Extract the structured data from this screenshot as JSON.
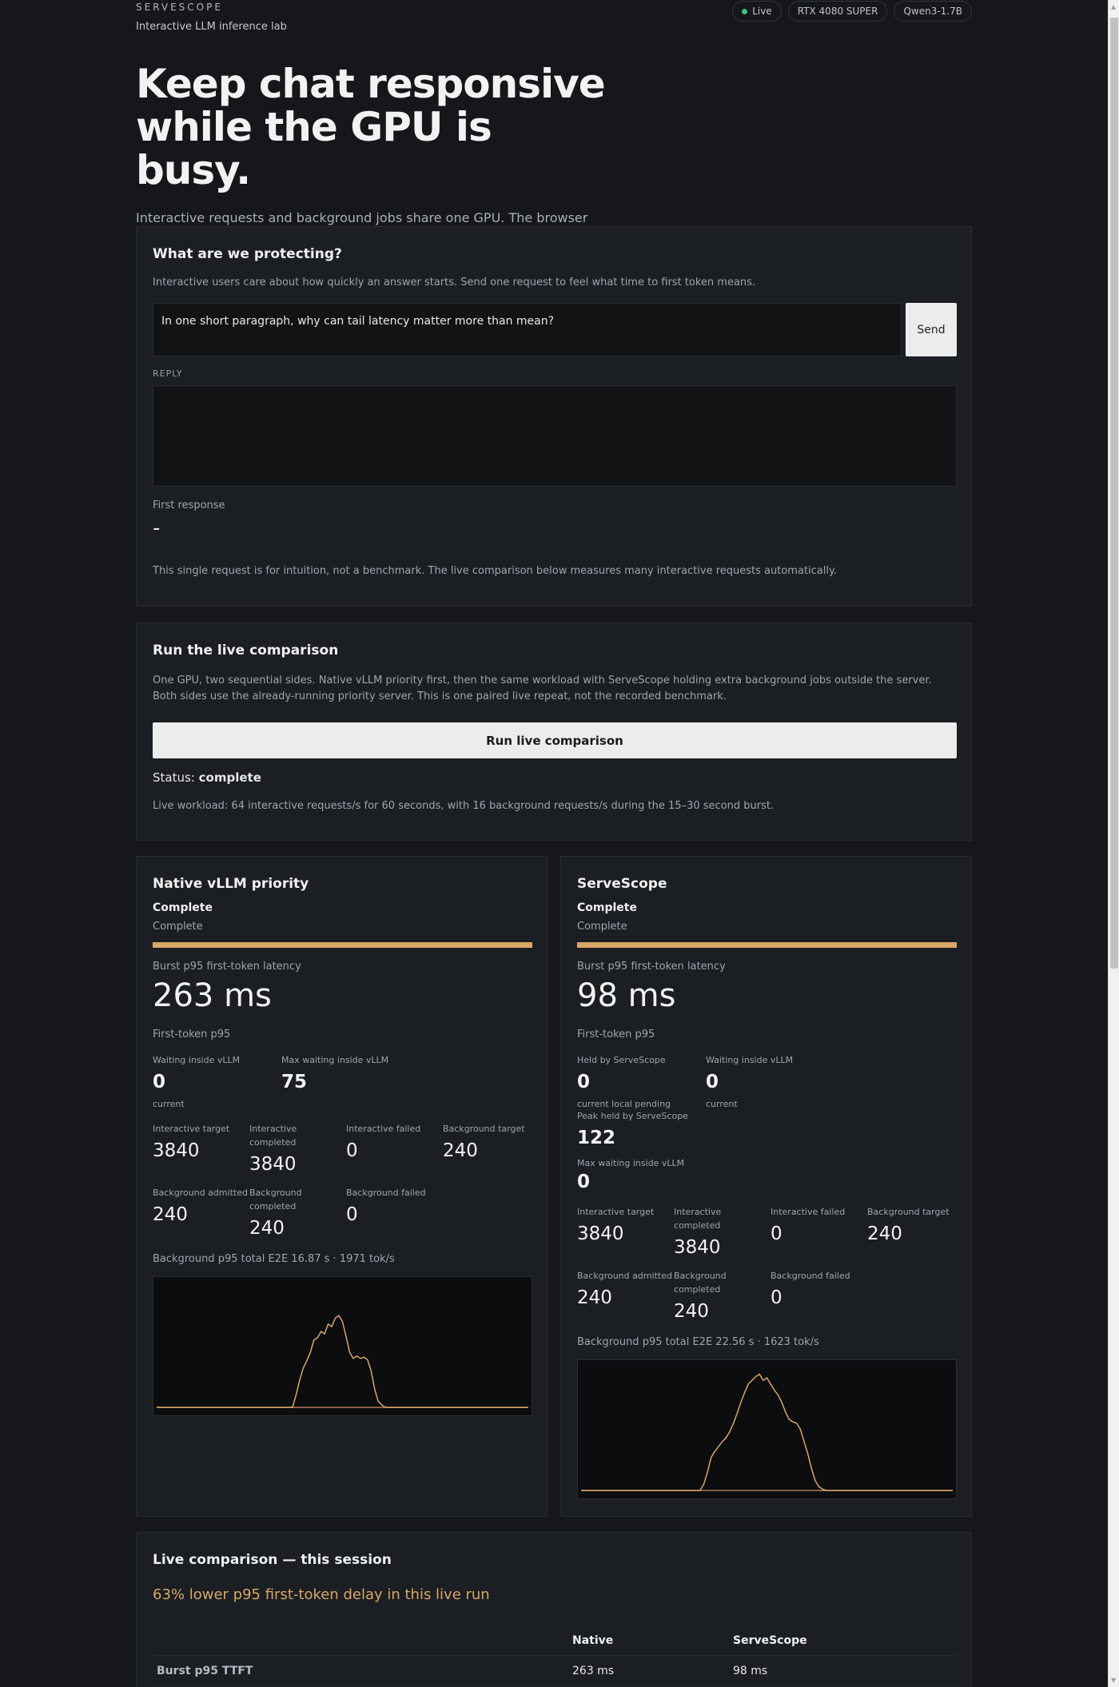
{
  "header": {
    "brand": "SERVESCOPE",
    "tagline": "Interactive LLM inference lab",
    "pills": {
      "live": "Live",
      "gpu": "RTX 4080 SUPER",
      "model": "Qwen3-1.7B"
    }
  },
  "hero": {
    "title": "Keep chat responsive while the GPU is busy.",
    "subtitle": "Interactive requests and background jobs share one GPU. The browser can run one paired comparison of native priority versus ServeScope admission."
  },
  "protect": {
    "title": "What are we protecting?",
    "intro": "Interactive users care about how quickly an answer starts. Send one request to feel what time to first token means.",
    "prompt_value": "In one short paragraph, why can tail latency matter more than mean?",
    "send_label": "Send",
    "reply_label": "REPLY",
    "reply_value": "",
    "first_response_label": "First response",
    "first_response_value": "-",
    "note": "This single request is for intuition, not a benchmark. The live comparison below measures many interactive requests automatically."
  },
  "run": {
    "title": "Run the live comparison",
    "description": "One GPU, two sequential sides. Native vLLM priority first, then the same workload with ServeScope holding extra background jobs outside the server. Both sides use the already-running priority server. This is one paired live repeat, not the recorded benchmark.",
    "button_label": "Run live comparison",
    "status_label": "Status:",
    "status_value": "complete",
    "workload": "Live workload: 64 interactive requests/s for 60 seconds, with 16 background requests/s during the 15–30 second burst."
  },
  "native": {
    "title": "Native vLLM priority",
    "state": "Complete",
    "state_sub": "Complete",
    "progress": 1.0,
    "metric_label": "Burst p95 first-token latency",
    "metric_value": "263 ms",
    "sub_label": "First-token p95",
    "waiting_label": "Waiting inside vLLM",
    "waiting_value": "0",
    "waiting_caption": "current",
    "max_waiting_label": "Max waiting inside vLLM",
    "max_waiting_value": "75",
    "stats": [
      {
        "label": "Interactive target",
        "value": "3840"
      },
      {
        "label": "Interactive completed",
        "value": "3840"
      },
      {
        "label": "Interactive failed",
        "value": "0"
      },
      {
        "label": "Background target",
        "value": "240"
      },
      {
        "label": "Background admitted",
        "value": "240"
      },
      {
        "label": "Background completed",
        "value": "240"
      },
      {
        "label": "Background failed",
        "value": "0"
      }
    ],
    "bg_line": "Background p95 total E2E 16.87 s · 1971 tok/s",
    "series": [
      0,
      0,
      0,
      0,
      0,
      0,
      0,
      0,
      0,
      0,
      0,
      0,
      0,
      0,
      0,
      0,
      0,
      0,
      0,
      0,
      0,
      0,
      0,
      0,
      0,
      0,
      0,
      0,
      0,
      0,
      0,
      0,
      0,
      0,
      0,
      0,
      0,
      0,
      0,
      0.1,
      0.22,
      0.32,
      0.38,
      0.45,
      0.55,
      0.57,
      0.62,
      0.6,
      0.68,
      0.66,
      0.73,
      0.75,
      0.7,
      0.58,
      0.45,
      0.4,
      0.42,
      0.4,
      0.41,
      0.39,
      0.3,
      0.15,
      0.05,
      0.02,
      0,
      0,
      0,
      0,
      0,
      0,
      0,
      0,
      0,
      0,
      0,
      0,
      0,
      0,
      0,
      0,
      0,
      0,
      0,
      0,
      0,
      0,
      0,
      0,
      0,
      0,
      0,
      0,
      0,
      0,
      0,
      0,
      0,
      0,
      0,
      0,
      0,
      0,
      0,
      0,
      0
    ]
  },
  "serve": {
    "title": "ServeScope",
    "state": "Complete",
    "state_sub": "Complete",
    "progress": 1.0,
    "metric_label": "Burst p95 first-token latency",
    "metric_value": "98 ms",
    "sub_label": "First-token p95",
    "held_label": "Held by ServeScope",
    "held_value": "0",
    "held_caption": "current local pending",
    "waiting_label": "Waiting inside vLLM",
    "waiting_value": "0",
    "waiting_caption": "current",
    "peak_label": "Peak held by ServeScope",
    "peak_value": "122",
    "max_waiting_label": "Max waiting inside vLLM",
    "max_waiting_value": "0",
    "stats": [
      {
        "label": "Interactive target",
        "value": "3840"
      },
      {
        "label": "Interactive completed",
        "value": "3840"
      },
      {
        "label": "Interactive failed",
        "value": "0"
      },
      {
        "label": "Background target",
        "value": "240"
      },
      {
        "label": "Background admitted",
        "value": "240"
      },
      {
        "label": "Background completed",
        "value": "240"
      },
      {
        "label": "Background failed",
        "value": "0"
      }
    ],
    "bg_line": "Background p95 total E2E 22.56 s · 1623 tok/s",
    "series": [
      0,
      0,
      0,
      0,
      0,
      0,
      0,
      0,
      0,
      0,
      0,
      0,
      0,
      0,
      0,
      0,
      0,
      0,
      0,
      0,
      0,
      0,
      0,
      0,
      0,
      0,
      0,
      0,
      0,
      0,
      0,
      0,
      0,
      0.05,
      0.15,
      0.27,
      0.32,
      0.36,
      0.4,
      0.43,
      0.48,
      0.55,
      0.63,
      0.72,
      0.8,
      0.87,
      0.9,
      0.93,
      0.95,
      0.9,
      0.92,
      0.87,
      0.82,
      0.78,
      0.72,
      0.64,
      0.58,
      0.56,
      0.55,
      0.5,
      0.4,
      0.3,
      0.18,
      0.08,
      0.03,
      0.01,
      0,
      0,
      0,
      0,
      0,
      0,
      0,
      0,
      0,
      0,
      0,
      0,
      0,
      0,
      0,
      0,
      0,
      0,
      0,
      0,
      0,
      0,
      0,
      0,
      0,
      0,
      0,
      0,
      0,
      0,
      0,
      0,
      0,
      0,
      0
    ]
  },
  "summary": {
    "title": "Live comparison — this session",
    "headline": "63% lower p95 first-token delay in this live run",
    "columns": [
      "",
      "Native",
      "ServeScope"
    ],
    "rows": [
      {
        "label": "Burst p95 TTFT",
        "native": "263 ms",
        "serve": "98 ms"
      }
    ]
  },
  "colors": {
    "accent": "#d8a867",
    "live_dot": "#3fbf8a",
    "background": "#15171a",
    "card": "#1b1e22"
  }
}
